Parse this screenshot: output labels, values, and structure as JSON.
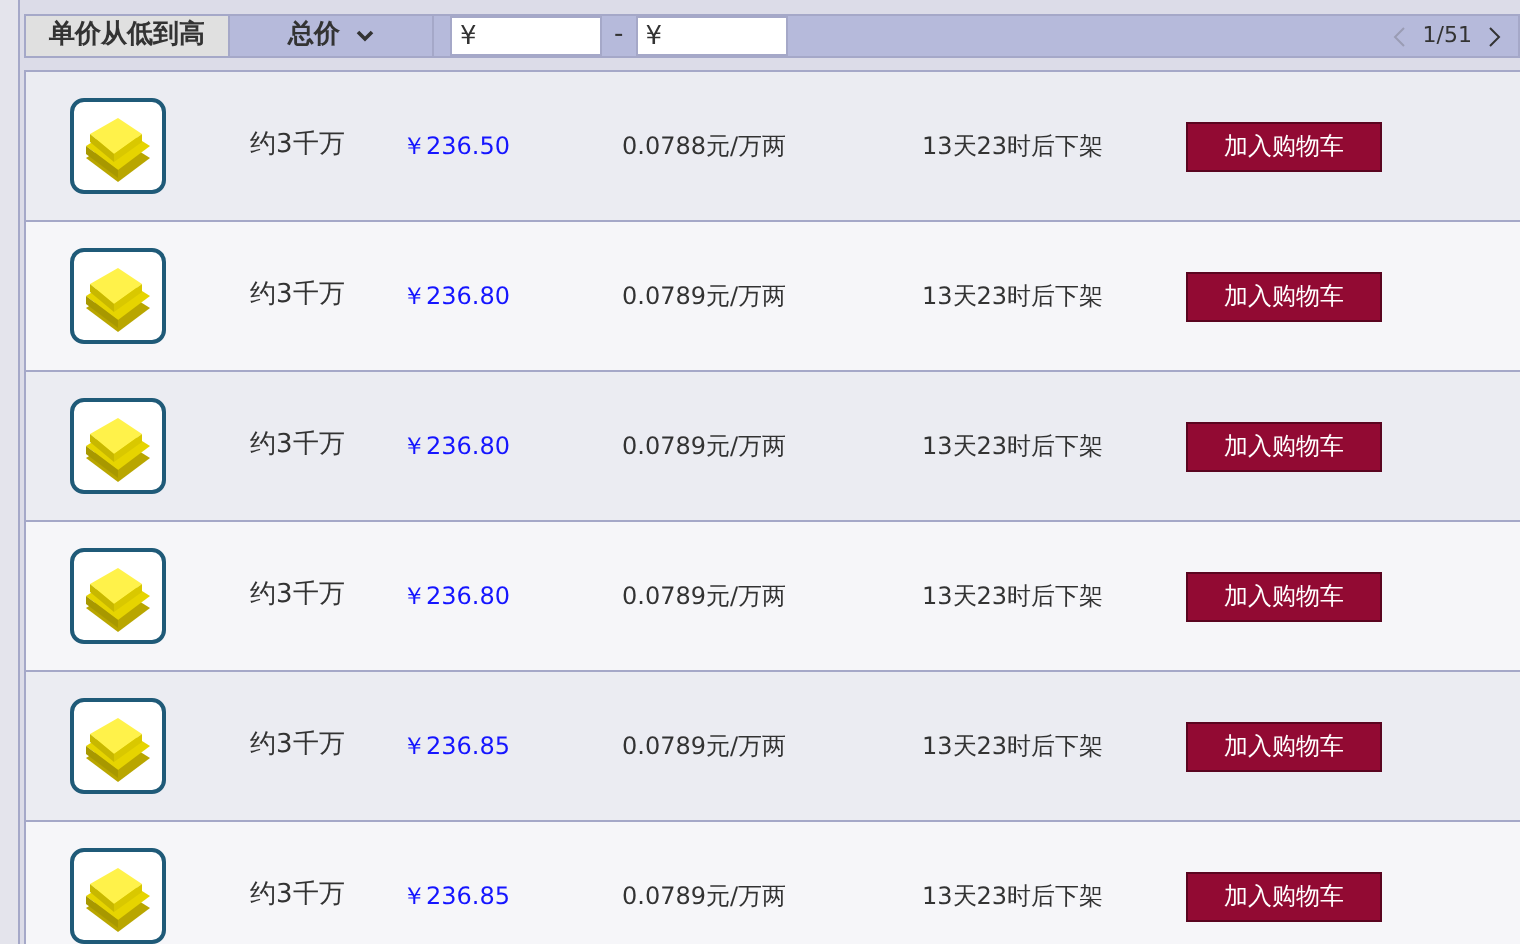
{
  "sort_tabs": [
    {
      "label": "单价从低到高",
      "selected": true,
      "chevron": false
    },
    {
      "label": "总价",
      "selected": false,
      "chevron": true
    }
  ],
  "price_filter": {
    "min_value": "¥",
    "separator": "-",
    "max_value": "¥"
  },
  "pagination": {
    "page": "1/51",
    "prev_disabled": true,
    "next_disabled": false
  },
  "listings": [
    {
      "amount": "约3千万",
      "price": "￥236.50",
      "unit_price": "0.0788元/万两",
      "time_left": "13天23时后下架",
      "button": "加入购物车"
    },
    {
      "amount": "约3千万",
      "price": "￥236.80",
      "unit_price": "0.0789元/万两",
      "time_left": "13天23时后下架",
      "button": "加入购物车"
    },
    {
      "amount": "约3千万",
      "price": "￥236.80",
      "unit_price": "0.0789元/万两",
      "time_left": "13天23时后下架",
      "button": "加入购物车"
    },
    {
      "amount": "约3千万",
      "price": "￥236.80",
      "unit_price": "0.0789元/万两",
      "time_left": "13天23时后下架",
      "button": "加入购物车"
    },
    {
      "amount": "约3千万",
      "price": "￥236.85",
      "unit_price": "0.0789元/万两",
      "time_left": "13天23时后下架",
      "button": "加入购物车"
    },
    {
      "amount": "约3千万",
      "price": "￥236.85",
      "unit_price": "0.0789元/万两",
      "time_left": "13天23时后下架",
      "button": "加入购物车"
    }
  ]
}
